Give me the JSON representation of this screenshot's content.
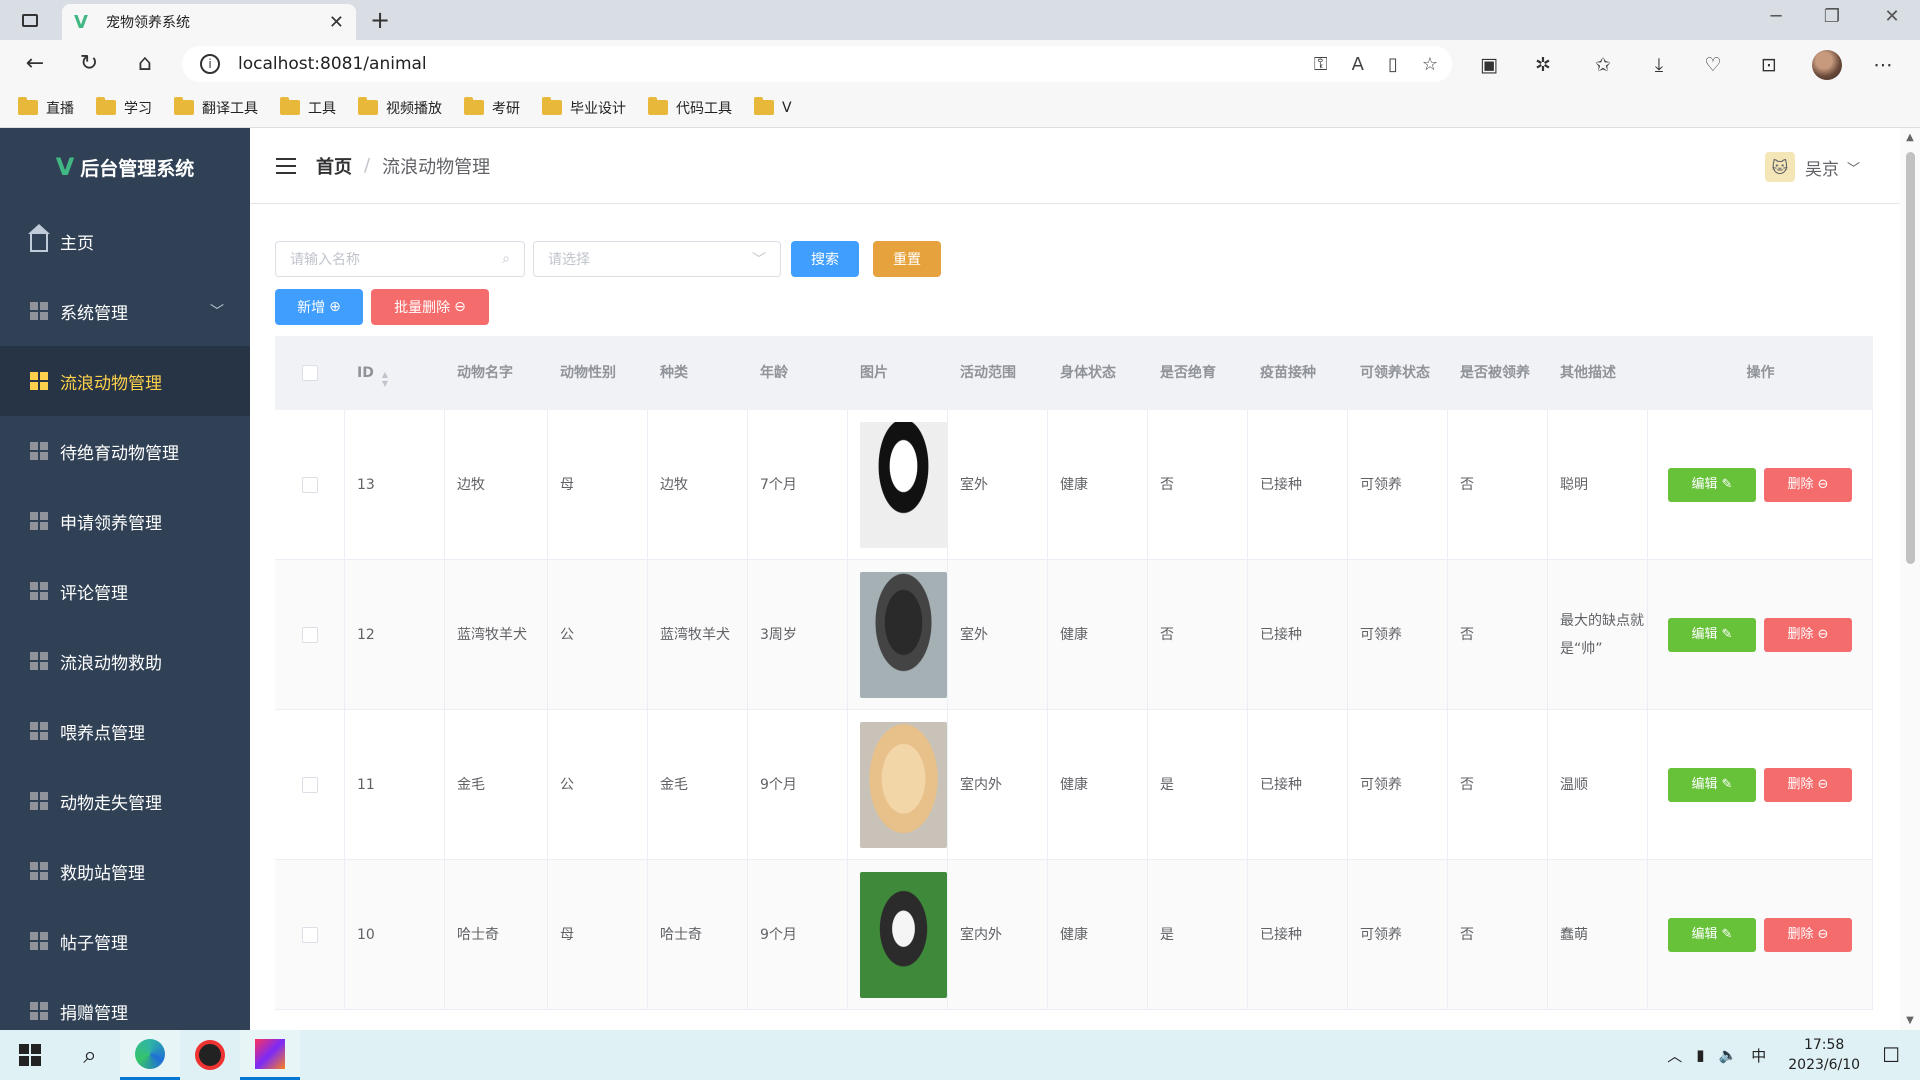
{
  "browser": {
    "tab_title": "宠物领养系统",
    "url": "localhost:8081/animal",
    "bookmarks": [
      "直播",
      "学习",
      "翻译工具",
      "工具",
      "视频播放",
      "考研",
      "毕业设计",
      "代码工具",
      "V"
    ]
  },
  "app": {
    "logo": "后台管理系统",
    "menu": [
      {
        "label": "主页",
        "icon": "home-icon"
      },
      {
        "label": "系统管理",
        "icon": "grid-icon",
        "has_submenu": true
      },
      {
        "label": "流浪动物管理",
        "icon": "grid-icon",
        "active": true
      },
      {
        "label": "待绝育动物管理",
        "icon": "grid-icon"
      },
      {
        "label": "申请领养管理",
        "icon": "grid-icon"
      },
      {
        "label": "评论管理",
        "icon": "grid-icon"
      },
      {
        "label": "流浪动物救助",
        "icon": "grid-icon"
      },
      {
        "label": "喂养点管理",
        "icon": "grid-icon"
      },
      {
        "label": "动物走失管理",
        "icon": "grid-icon"
      },
      {
        "label": "救助站管理",
        "icon": "grid-icon"
      },
      {
        "label": "帖子管理",
        "icon": "grid-icon"
      },
      {
        "label": "捐赠管理",
        "icon": "grid-icon"
      }
    ],
    "breadcrumb": {
      "home": "首页",
      "separator": "/",
      "current": "流浪动物管理"
    },
    "user": "吴京"
  },
  "toolbar": {
    "name_placeholder": "请输入名称",
    "select_placeholder": "请选择",
    "search_label": "搜索",
    "reset_label": "重置",
    "add_label": "新增",
    "batch_delete_label": "批量删除"
  },
  "table": {
    "headers": [
      "ID",
      "动物名字",
      "动物性别",
      "种类",
      "年龄",
      "图片",
      "活动范围",
      "身体状态",
      "是否绝育",
      "疫苗接种",
      "可领养状态",
      "是否被领养",
      "其他描述",
      "操作"
    ],
    "edit_label": "编辑",
    "delete_label": "删除",
    "rows": [
      {
        "id": "13",
        "name": "边牧",
        "sex": "母",
        "kind": "边牧",
        "age": "7个月",
        "photo": "dog-photo-border-collie",
        "range": "室外",
        "health": "健康",
        "neutered": "否",
        "vaccine": "已接种",
        "adoptable": "可领养",
        "adopted": "否",
        "desc": "聪明"
      },
      {
        "id": "12",
        "name": "蓝湾牧羊犬",
        "sex": "公",
        "kind": "蓝湾牧羊犬",
        "age": "3周岁",
        "photo": "dog-photo-shepherd",
        "range": "室外",
        "health": "健康",
        "neutered": "否",
        "vaccine": "已接种",
        "adoptable": "可领养",
        "adopted": "否",
        "desc": "最大的缺点就是“帅”"
      },
      {
        "id": "11",
        "name": "金毛",
        "sex": "公",
        "kind": "金毛",
        "age": "9个月",
        "photo": "dog-photo-golden",
        "range": "室内外",
        "health": "健康",
        "neutered": "是",
        "vaccine": "已接种",
        "adoptable": "可领养",
        "adopted": "否",
        "desc": "温顺"
      },
      {
        "id": "10",
        "name": "哈士奇",
        "sex": "母",
        "kind": "哈士奇",
        "age": "9个月",
        "photo": "dog-photo-husky",
        "range": "室内外",
        "health": "健康",
        "neutered": "是",
        "vaccine": "已接种",
        "adoptable": "可领养",
        "adopted": "否",
        "desc": "蠢萌"
      }
    ]
  },
  "taskbar": {
    "time": "17:58",
    "date": "2023/6/10",
    "ime": "中"
  }
}
